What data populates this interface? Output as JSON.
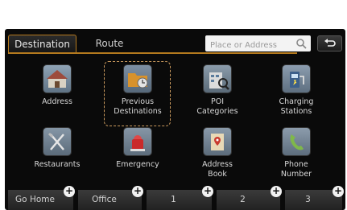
{
  "tabs": {
    "destination": "Destination",
    "route": "Route"
  },
  "search": {
    "placeholder": "Place or Address"
  },
  "grid": [
    {
      "label": "Address",
      "icon": "house-icon"
    },
    {
      "label": "Previous\nDestinations",
      "icon": "folder-icon"
    },
    {
      "label": "POI\nCategories",
      "icon": "poi-icon"
    },
    {
      "label": "Charging\nStations",
      "icon": "charging-station-icon"
    },
    {
      "label": "Restaurants",
      "icon": "restaurant-icon"
    },
    {
      "label": "Emergency",
      "icon": "emergency-icon"
    },
    {
      "label": "Address\nBook",
      "icon": "address-book-icon"
    },
    {
      "label": "Phone\nNumber",
      "icon": "phone-icon"
    }
  ],
  "quick_buttons": [
    {
      "label": "Go Home"
    },
    {
      "label": "Office"
    },
    {
      "label": "1"
    },
    {
      "label": "2"
    },
    {
      "label": "3"
    }
  ],
  "colors": {
    "accent": "#b57a1e",
    "background": "#0a0a0a",
    "selection": "#c8985c"
  }
}
